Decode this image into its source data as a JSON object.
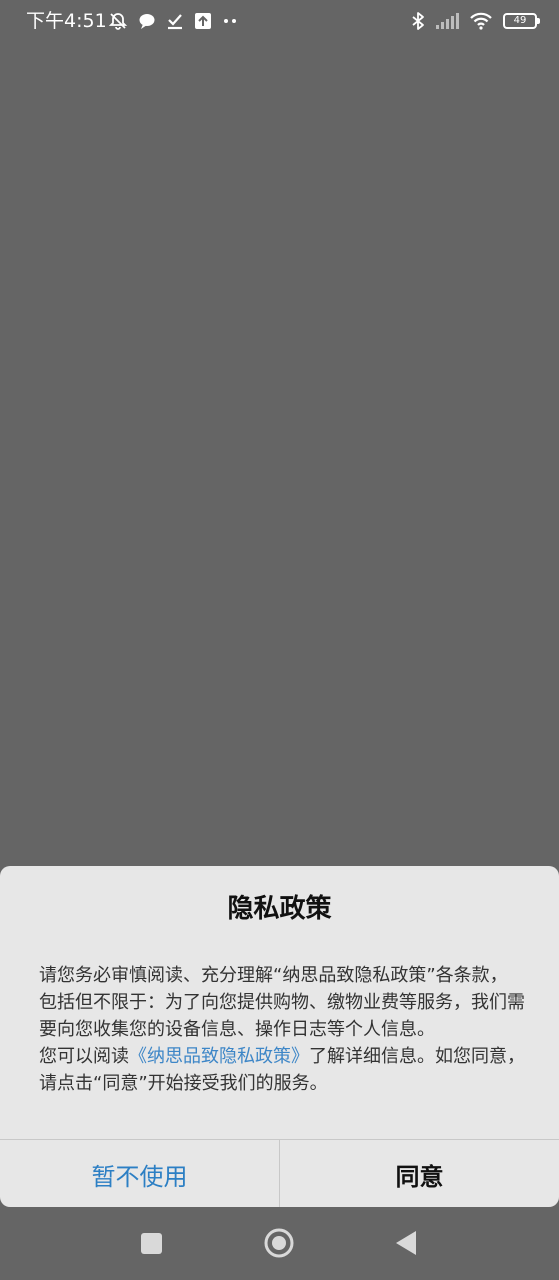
{
  "status_bar": {
    "time": "下午4:51",
    "battery": "49",
    "icons": [
      "notifications-muted-icon",
      "chat-bubble-icon",
      "task-done-icon",
      "upload-icon",
      "more-dots-icon",
      "bluetooth-icon",
      "cell-signal-icon",
      "wifi-icon",
      "battery-icon"
    ]
  },
  "dialog": {
    "title": "隐私政策",
    "body_intro": "请您务必审慎阅读、充分理解“纳思品致隐私政策”各条款，包括但不限于：为了向您提供购物、缴物业费等服务，我们需要向您收集您的设备信息、操作日志等个人信息。",
    "body_read_prefix": "您可以阅读",
    "policy_link": "《纳思品致隐私政策》",
    "body_suffix": "了解详细信息。如您同意，请点击“同意”开始接受我们的服务。",
    "decline_label": "暂不使用",
    "agree_label": "同意"
  },
  "nav_bar": {
    "icons": [
      "recents-square-icon",
      "home-circle-icon",
      "back-triangle-icon"
    ]
  },
  "colors": {
    "background": "#656565",
    "dialog": "#e7e7e7",
    "link": "#3d86c7",
    "decline": "#2c7fc4"
  }
}
